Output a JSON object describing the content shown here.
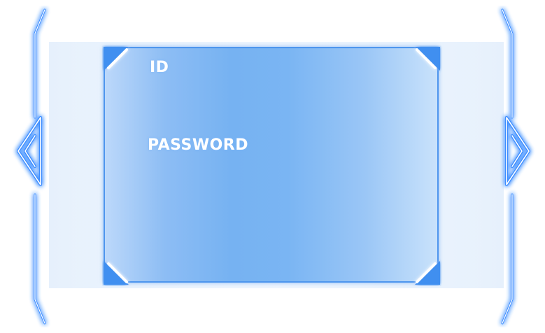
{
  "login": {
    "id_label": "ID",
    "password_label": "PASSWORD",
    "id_value": "",
    "password_value": ""
  },
  "nav": {
    "prev_icon": "chevron-left-icon",
    "next_icon": "chevron-right-icon"
  },
  "colors": {
    "frame": "#4e96ee",
    "glow": "#3a8cff",
    "panel_center": "#76b2f2",
    "panel_edge": "#c9e2fb",
    "label": "#ffffff"
  }
}
